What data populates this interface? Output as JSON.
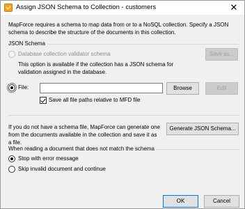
{
  "window": {
    "title": "Assign JSON Schema to Collection - customers",
    "close_glyph": "✕",
    "icon": "mapforce-app-icon"
  },
  "description": "MapForce requires a schema to map data from or to a NoSQL collection. Specify a JSON schema to describe the structure of the documents in this collection.",
  "json_schema_group": {
    "label": "JSON Schema",
    "db_validator_label": "Database collection validator schema",
    "db_validator_note": "This option is available if the collection has a JSON schema for validation assigned in the database.",
    "save_as_label": "Save as...",
    "file_label": "File:",
    "file_value": "",
    "browse_label": "Browse",
    "edit_label": "Edit",
    "save_paths_label": "Save all file paths relative to MFD file",
    "save_paths_checked": true,
    "selected": "file"
  },
  "generate": {
    "text": "If you do not have a schema file, MapForce can generate one from the documents available in the collection and save it as a file.",
    "button_label": "Generate JSON Schema..."
  },
  "mismatch_group": {
    "label": "When reading a document that does not match the schema",
    "option_stop": "Stop with error message",
    "option_skip": "Skip invalid document and continue",
    "selected": "stop"
  },
  "footer": {
    "ok_label": "OK",
    "cancel_label": "Cancel"
  }
}
